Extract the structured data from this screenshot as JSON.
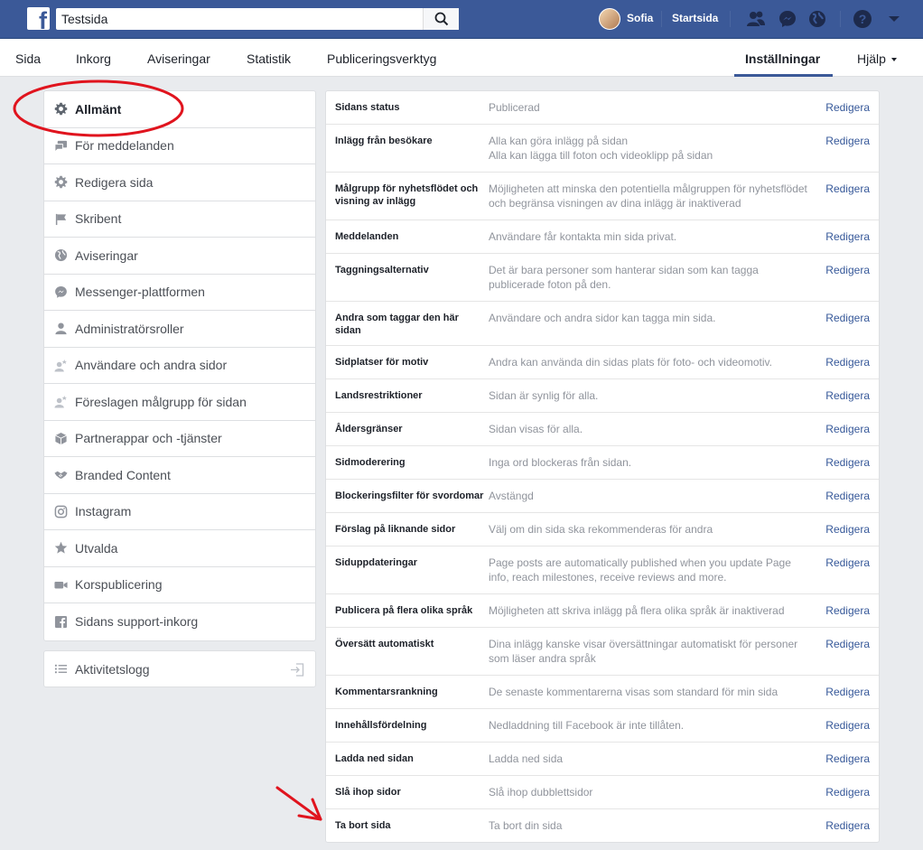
{
  "topbar": {
    "search_value": "Testsida",
    "user_name": "Sofia",
    "home_label": "Startsida"
  },
  "pagenav": {
    "tabs": [
      {
        "label": "Sida"
      },
      {
        "label": "Inkorg"
      },
      {
        "label": "Aviseringar"
      },
      {
        "label": "Statistik"
      },
      {
        "label": "Publiceringsverktyg"
      }
    ],
    "settings_label": "Inställningar",
    "help_label": "Hjälp"
  },
  "leftmenu": {
    "items": [
      {
        "label": "Allmänt"
      },
      {
        "label": "För meddelanden"
      },
      {
        "label": "Redigera sida"
      },
      {
        "label": "Skribent"
      },
      {
        "label": "Aviseringar"
      },
      {
        "label": "Messenger-plattformen"
      },
      {
        "label": "Administratörsroller"
      },
      {
        "label": "Användare och andra sidor"
      },
      {
        "label": "Föreslagen målgrupp för sidan"
      },
      {
        "label": "Partnerappar och -tjänster"
      },
      {
        "label": "Branded Content"
      },
      {
        "label": "Instagram"
      },
      {
        "label": "Utvalda"
      },
      {
        "label": "Korspublicering"
      },
      {
        "label": "Sidans support-inkorg"
      }
    ],
    "activity_label": "Aktivitetslogg"
  },
  "settings": {
    "edit_label": "Redigera",
    "rows": [
      {
        "label": "Sidans status",
        "desc": "Publicerad"
      },
      {
        "label": "Inlägg från besökare",
        "desc": "Alla kan göra inlägg på sidan",
        "desc2": "Alla kan lägga till foton och videoklipp på sidan"
      },
      {
        "label": "Målgrupp för nyhetsflödet och visning av inlägg",
        "desc": "Möjligheten att minska den potentiella målgruppen för nyhetsflödet och begränsa visningen av dina inlägg är inaktiverad"
      },
      {
        "label": "Meddelanden",
        "desc": "Användare får kontakta min sida privat."
      },
      {
        "label": "Taggningsalternativ",
        "desc": "Det är bara personer som hanterar sidan som kan tagga publicerade foton på den."
      },
      {
        "label": "Andra som taggar den här sidan",
        "desc": "Användare och andra sidor kan tagga min sida."
      },
      {
        "label": "Sidplatser för motiv",
        "desc": "Andra kan använda din sidas plats för foto- och videomotiv."
      },
      {
        "label": "Landsrestriktioner",
        "desc": "Sidan är synlig för alla."
      },
      {
        "label": "Åldersgränser",
        "desc": "Sidan visas för alla."
      },
      {
        "label": "Sidmoderering",
        "desc": "Inga ord blockeras från sidan."
      },
      {
        "label": "Blockeringsfilter för svordomar",
        "desc": "Avstängd"
      },
      {
        "label": "Förslag på liknande sidor",
        "desc": "Välj om din sida ska rekommenderas för andra"
      },
      {
        "label": "Siduppdateringar",
        "desc": "Page posts are automatically published when you update Page info, reach milestones, receive reviews and more."
      },
      {
        "label": "Publicera på flera olika språk",
        "desc": "Möjligheten att skriva inlägg på flera olika språk är inaktiverad"
      },
      {
        "label": "Översätt automatiskt",
        "desc": "Dina inlägg kanske visar översättningar automatiskt för personer som läser andra språk"
      },
      {
        "label": "Kommentarsrankning",
        "desc": "De senaste kommentarerna visas som standard för min sida"
      },
      {
        "label": "Innehållsfördelning",
        "desc": "Nedladdning till Facebook är inte tillåten."
      },
      {
        "label": "Ladda ned sidan",
        "desc": "Ladda ned sida"
      },
      {
        "label": "Slå ihop sidor",
        "desc": "Slå ihop dubblettsidor"
      },
      {
        "label": "Ta bort sida",
        "desc": "Ta bort din sida"
      }
    ]
  },
  "colors": {
    "brand_blue": "#3b5998",
    "link_blue": "#365899",
    "annotation_red": "#e0141e"
  }
}
